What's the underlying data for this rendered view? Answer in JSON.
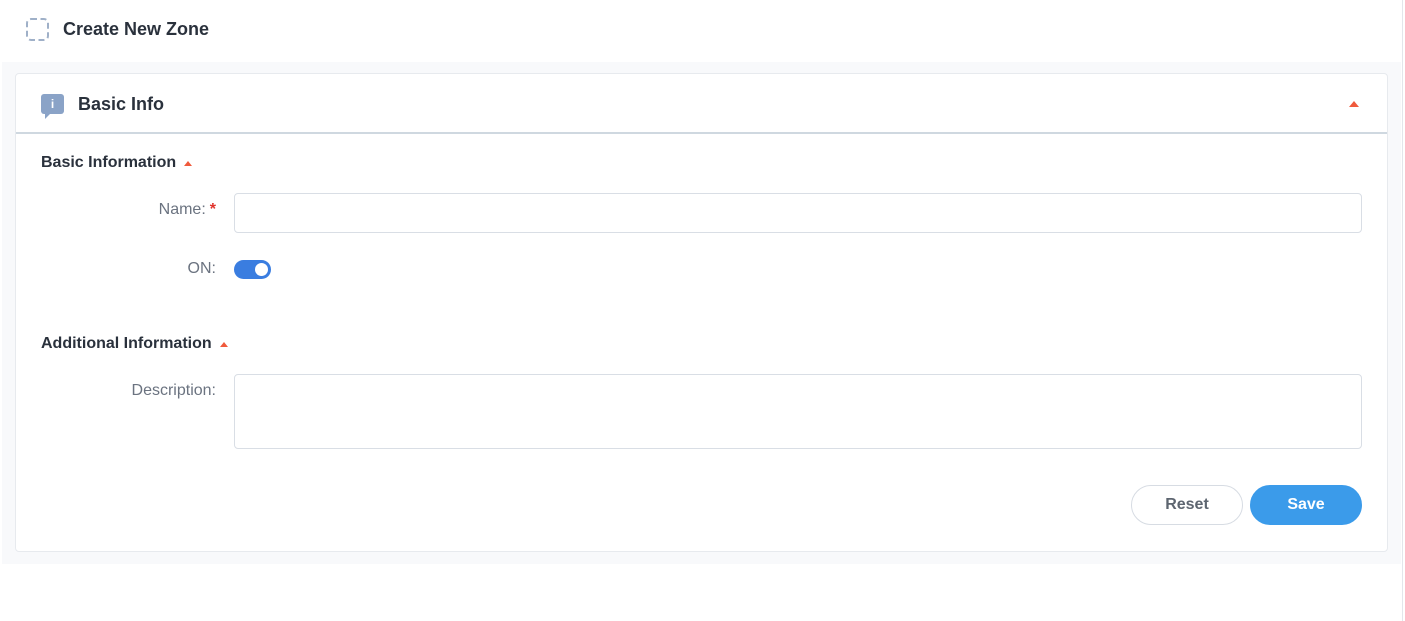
{
  "page": {
    "title": "Create New Zone",
    "icon": "zone-dashed-square-icon"
  },
  "card": {
    "title": "Basic Info",
    "icon": "info-icon",
    "collapse_icon": "caret-up-icon"
  },
  "sections": {
    "basic": {
      "title": "Basic Information",
      "name_label": "Name:",
      "name_required": "*",
      "name_value": "",
      "on_label": "ON:",
      "on_state": true
    },
    "additional": {
      "title": "Additional Information",
      "description_label": "Description:",
      "description_value": ""
    }
  },
  "actions": {
    "reset_label": "Reset",
    "save_label": "Save"
  },
  "colors": {
    "accent": "#3b9bea",
    "toggle": "#3a7de0",
    "caret": "#f05a3c",
    "required": "#e0322b"
  }
}
